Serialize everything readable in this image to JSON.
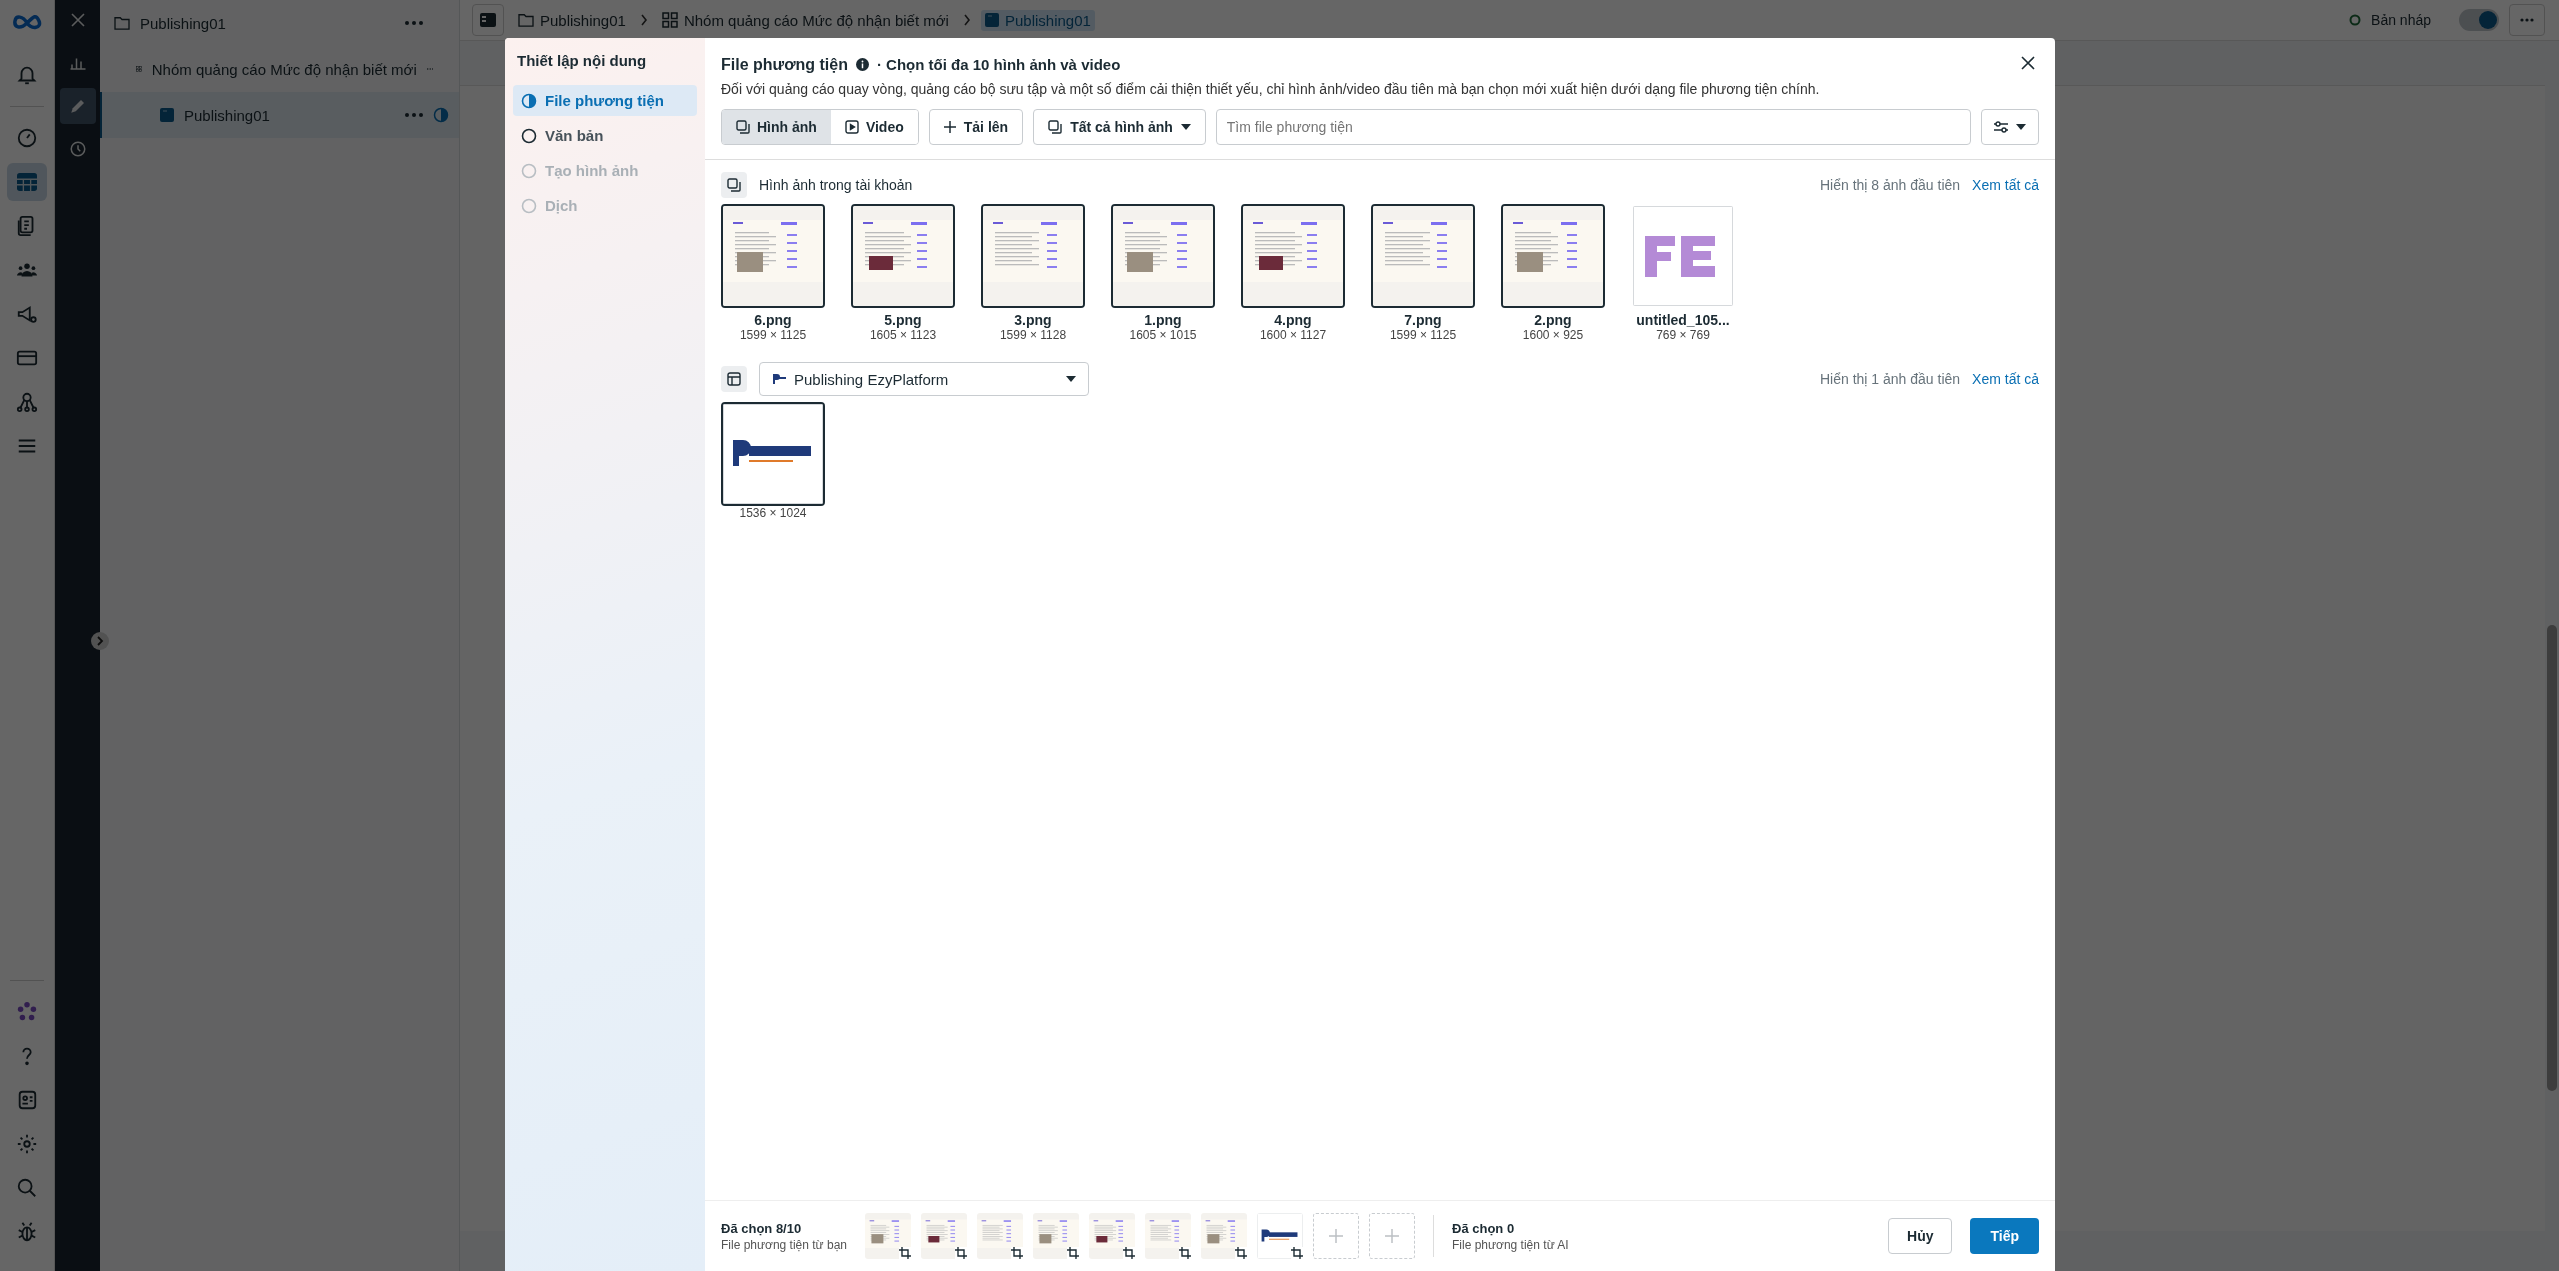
{
  "nav_rail": {
    "top_items": [
      {
        "selected": false
      }
    ],
    "main_items": [
      {
        "selected": false
      },
      {
        "selected": true
      },
      {
        "selected": false
      },
      {
        "selected": false
      },
      {
        "selected": false
      },
      {
        "selected": false
      },
      {
        "selected": false
      },
      {
        "selected": false
      }
    ],
    "bottom_items": [
      {
        "selected": false
      },
      {
        "selected": false
      },
      {
        "selected": false
      },
      {
        "selected": false
      },
      {
        "selected": false
      },
      {
        "selected": false
      }
    ]
  },
  "tool_strip": {
    "items": [
      {
        "selected": false
      },
      {
        "selected": true
      },
      {
        "selected": false
      }
    ]
  },
  "tree": [
    {
      "label": "Publishing01",
      "kind": "folder",
      "selected": false,
      "draft": false,
      "children": [
        {
          "label": "Nhóm quảng cáo Mức độ nhận biết mới",
          "kind": "group",
          "selected": false,
          "draft": false,
          "children": [
            {
              "label": "Publishing01",
              "kind": "ad",
              "selected": true,
              "draft": true
            }
          ]
        }
      ]
    }
  ],
  "topbar": {
    "breadcrumb": [
      {
        "label": "Publishing01",
        "kind": "folder",
        "selected": false
      },
      {
        "label": "Nhóm quảng cáo Mức độ nhận biết mới",
        "kind": "group",
        "selected": false
      },
      {
        "label": "Publishing01",
        "kind": "ad",
        "selected": true
      }
    ],
    "status": "Bản nháp",
    "toggle_on": true
  },
  "modal": {
    "sidebar": {
      "title": "Thiết lập nội dung",
      "steps": [
        {
          "label": "File phương tiện",
          "selected": true,
          "disabled": false
        },
        {
          "label": "Văn bản",
          "selected": false,
          "disabled": false
        },
        {
          "label": "Tạo hình ảnh",
          "selected": false,
          "disabled": true
        },
        {
          "label": "Dịch",
          "selected": false,
          "disabled": true
        }
      ]
    },
    "title": "File phương tiện",
    "subtitle": "· Chọn tối đa 10 hình ảnh và video",
    "description": "Đối với quảng cáo quay vòng, quảng cáo bộ sưu tập và một số điểm cải thiện thiết yếu, chỉ hình ảnh/video đầu tiên mà bạn chọn mới xuất hiện dưới dạng file phương tiện chính.",
    "toolbar": {
      "media_types": [
        {
          "label": "Hình ảnh",
          "selected": true
        },
        {
          "label": "Video",
          "selected": false
        }
      ],
      "upload": "Tải lên",
      "filter": "Tất cả hình ảnh",
      "search": {
        "placeholder": "Tìm file phương tiện"
      }
    },
    "sections": [
      {
        "kind": "label",
        "title": "Hình ảnh trong tài khoản",
        "count_text": "Hiển thị 8 ảnh đầu tiên",
        "link": "Xem tất cả",
        "images": [
          {
            "name": "6.png",
            "size": "1599 × 1125",
            "selected": true,
            "kind": "screenshot"
          },
          {
            "name": "5.png",
            "size": "1605 × 1123",
            "selected": true,
            "kind": "screenshot"
          },
          {
            "name": "3.png",
            "size": "1599 × 1128",
            "selected": true,
            "kind": "screenshot"
          },
          {
            "name": "1.png",
            "size": "1605 × 1015",
            "selected": true,
            "kind": "screenshot"
          },
          {
            "name": "4.png",
            "size": "1600 × 1127",
            "selected": true,
            "kind": "screenshot"
          },
          {
            "name": "7.png",
            "size": "1599 × 1125",
            "selected": true,
            "kind": "screenshot"
          },
          {
            "name": "2.png",
            "size": "1600 × 925",
            "selected": true,
            "kind": "screenshot"
          },
          {
            "name": "untitled_105...",
            "size": "769 × 769",
            "selected": false,
            "kind": "logo"
          }
        ]
      },
      {
        "kind": "dropdown",
        "title": "Publishing EzyPlatform",
        "count_text": "Hiển thị 1 ảnh đầu tiên",
        "link": "Xem tất cả",
        "images": [
          {
            "size": "1536 × 1024",
            "selected": true,
            "kind": "logo"
          }
        ]
      }
    ],
    "footer": {
      "count": "Đã chọn 8/10",
      "source": "File phương tiện từ bạn",
      "slots": [
        {
          "filled": true
        },
        {
          "filled": true
        },
        {
          "filled": true
        },
        {
          "filled": true
        },
        {
          "filled": true
        },
        {
          "filled": true
        },
        {
          "filled": true
        },
        {
          "filled": true
        },
        {
          "filled": false
        },
        {
          "filled": false
        }
      ],
      "ai_count": "Đã chọn 0",
      "ai_source": "File phương tiện từ AI",
      "cancel": "Hủy",
      "next": "Tiếp"
    }
  }
}
